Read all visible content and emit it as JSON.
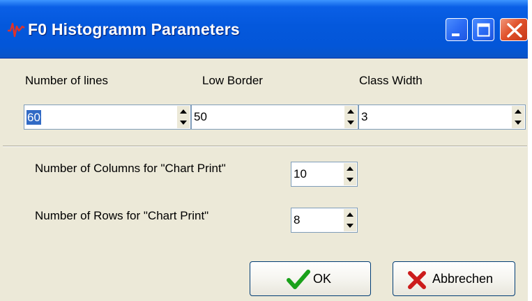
{
  "window": {
    "title": "F0 Histogramm Parameters",
    "icons": {
      "app": "pitch-wave-icon",
      "minimize": "minimize-icon",
      "maximize": "maximize-icon",
      "close": "close-icon"
    }
  },
  "top": {
    "number_of_lines": {
      "label": "Number of lines",
      "value": "60"
    },
    "low_border": {
      "label": "Low Border",
      "value": "50"
    },
    "class_width": {
      "label": "Class Width",
      "value": "3"
    }
  },
  "chart_print": {
    "columns": {
      "label": "Number of Columns for \"Chart Print\"",
      "value": "10"
    },
    "rows": {
      "label": "Number of Rows for \"Chart Print\"",
      "value": "8"
    }
  },
  "buttons": {
    "ok": {
      "label": "OK",
      "icon": "checkmark-icon"
    },
    "cancel": {
      "label": "Abbrechen",
      "icon": "x-cross-icon"
    }
  },
  "colors": {
    "titlebar": "#0458dc",
    "dialog": "#ece9d8",
    "selection": "#316ac5",
    "ok_check": "#1aa11a",
    "cancel_x": "#cc1c1c"
  }
}
